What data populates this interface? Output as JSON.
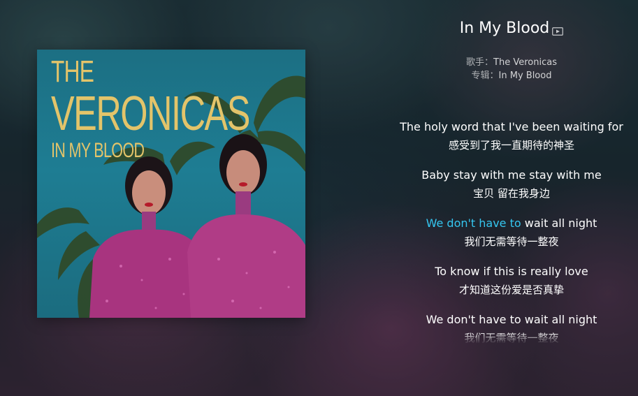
{
  "song": {
    "title": "In My Blood",
    "mv_icon": "video-play-icon",
    "artist_label": "歌手：",
    "artist": "The Veronicas",
    "album_label": "专辑：",
    "album": "In My Blood"
  },
  "cover": {
    "line1": "THE",
    "line2": "VERONICAS",
    "line3": "IN MY BLOOD"
  },
  "lyrics": [
    {
      "en": "The holy word that I've been waiting for",
      "zh": "感受到了我一直期待的神圣"
    },
    {
      "en": "Baby stay with me stay with me",
      "zh": "宝贝 留在我身边"
    },
    {
      "en_sung": "We don't have to ",
      "en_rest": "wait all night",
      "zh": "我们无需等待一整夜",
      "current": true
    },
    {
      "en": "To know if this is really love",
      "zh": "才知道这份爱是否真挚"
    },
    {
      "en": "We don't have to wait all night",
      "zh": "我们无需等待一整夜"
    }
  ],
  "colors": {
    "highlight": "#35c6f0",
    "cover_text": "#e3c46a"
  }
}
